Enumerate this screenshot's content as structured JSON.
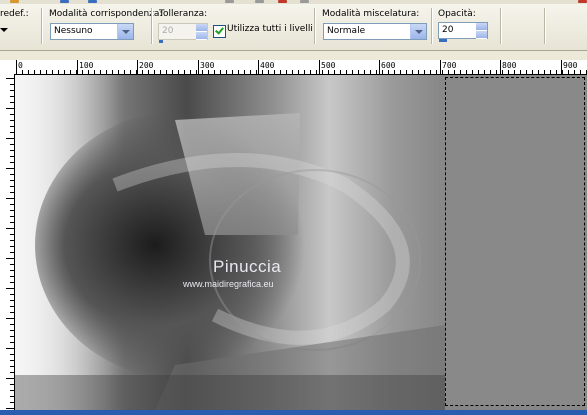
{
  "toolbar": {
    "preset_label": "redef.:",
    "match_mode": {
      "label": "Modalità corrispondenza:",
      "value": "Nessuno"
    },
    "tolerance": {
      "label": "Tolleranza:",
      "value": "20"
    },
    "use_all_layers": {
      "label": "Utilizza tutti i livelli",
      "checked": true
    },
    "blend_mode": {
      "label": "Modalità miscelatura:",
      "value": "Normale"
    },
    "opacity": {
      "label": "Opacità:",
      "value": "20"
    }
  },
  "ruler": {
    "ticks": [
      "0",
      "100",
      "200",
      "300",
      "400",
      "500",
      "600",
      "700",
      "800",
      "900"
    ]
  },
  "watermark": {
    "title": "Pinuccia",
    "url": "www.maidiregrafica.eu"
  },
  "colors": {
    "selection_fill": "#898989",
    "ruler_bg": "#ffffff",
    "toolbar_bg": "#ece9d8"
  }
}
